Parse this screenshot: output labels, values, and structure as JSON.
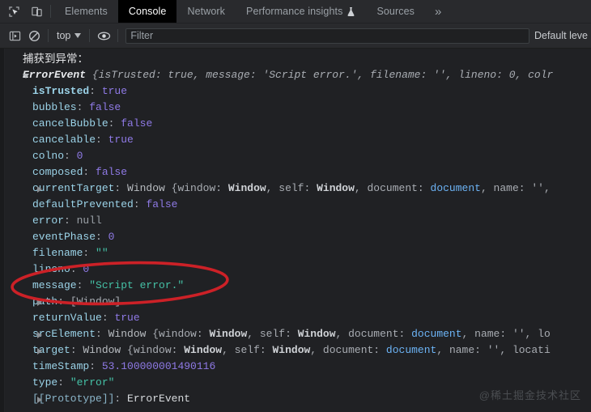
{
  "window": {
    "theme_bg": "#202124",
    "toolbar_bg": "#292a2d",
    "accent_active_tab_bg": "#000000",
    "annotation_color": "#cc2127"
  },
  "tabbar": {
    "icons": [
      {
        "name": "inspect-element-icon",
        "title": "Inspect element"
      },
      {
        "name": "device-toolbar-icon",
        "title": "Toggle device toolbar"
      }
    ],
    "tabs": [
      {
        "label": "Elements",
        "active": false
      },
      {
        "label": "Console",
        "active": true
      },
      {
        "label": "Network",
        "active": false
      },
      {
        "label": "Performance insights",
        "active": false,
        "badge": "flask-icon"
      },
      {
        "label": "Sources",
        "active": false
      }
    ],
    "overflow_label": "»"
  },
  "console_toolbar": {
    "sidebar_toggle": "show-console-sidebar-icon",
    "clear_console": "clear-console-icon",
    "context": {
      "value": "top",
      "caret": "chevron-down-icon"
    },
    "eye_icon": "live-expression-icon",
    "filter": {
      "value": "",
      "placeholder": "Filter"
    },
    "level": "Default leve"
  },
  "console_output": {
    "intro_text": "捕获到异常：",
    "header": {
      "ctor": "ErrorEvent",
      "preview": " {isTrusted: true, message: 'Script error.', filename: '', lineno: 0, colr",
      "expanded": true
    },
    "properties": [
      {
        "key": "isTrusted",
        "sep": ": ",
        "value": "true",
        "vtype": "bool",
        "own": true,
        "expandable": false
      },
      {
        "key": "bubbles",
        "sep": ": ",
        "value": "false",
        "vtype": "bool",
        "own": false,
        "expandable": false
      },
      {
        "key": "cancelBubble",
        "sep": ": ",
        "value": "false",
        "vtype": "bool",
        "own": false,
        "expandable": false
      },
      {
        "key": "cancelable",
        "sep": ": ",
        "value": "true",
        "vtype": "bool",
        "own": false,
        "expandable": false
      },
      {
        "key": "colno",
        "sep": ": ",
        "value": "0",
        "vtype": "num",
        "own": false,
        "expandable": false
      },
      {
        "key": "composed",
        "sep": ": ",
        "value": "false",
        "vtype": "bool",
        "own": false,
        "expandable": false
      },
      {
        "key": "currentTarget",
        "sep": ": ",
        "value": "Window",
        "vtype": "window",
        "own": false,
        "expandable": true
      },
      {
        "key": "defaultPrevented",
        "sep": ": ",
        "value": "false",
        "vtype": "bool",
        "own": false,
        "expandable": false
      },
      {
        "key": "error",
        "sep": ": ",
        "value": "null",
        "vtype": "null",
        "own": false,
        "expandable": false
      },
      {
        "key": "eventPhase",
        "sep": ": ",
        "value": "0",
        "vtype": "num",
        "own": false,
        "expandable": false
      },
      {
        "key": "filename",
        "sep": ": ",
        "value": "\"\"",
        "vtype": "str",
        "own": false,
        "expandable": false
      },
      {
        "key": "lineno",
        "sep": ": ",
        "value": "0",
        "vtype": "num",
        "own": false,
        "expandable": false
      },
      {
        "key": "message",
        "sep": ": ",
        "value": "\"Script error.\"",
        "vtype": "str",
        "own": false,
        "expandable": false
      },
      {
        "key": "path",
        "sep": ": ",
        "value": "[Window]",
        "vtype": "plain",
        "own": false,
        "expandable": true
      },
      {
        "key": "returnValue",
        "sep": ": ",
        "value": "true",
        "vtype": "bool",
        "own": false,
        "expandable": false
      },
      {
        "key": "srcElement",
        "sep": ": ",
        "value": "Window",
        "vtype": "window",
        "own": false,
        "expandable": true
      },
      {
        "key": "target",
        "sep": ": ",
        "value": "Window",
        "vtype": "window",
        "own": false,
        "expandable": true
      },
      {
        "key": "timeStamp",
        "sep": ": ",
        "value": "53.100000001490116",
        "vtype": "num",
        "own": false,
        "expandable": false
      },
      {
        "key": "type",
        "sep": ": ",
        "value": "\"error\"",
        "vtype": "str",
        "own": false,
        "expandable": false
      },
      {
        "key": "[[Prototype]]",
        "sep": ": ",
        "value": "ErrorEvent",
        "vtype": "ctor",
        "own": false,
        "expandable": true
      }
    ],
    "window_preview_currentTarget": " {window: Window, self: Window, document: document, name: '',",
    "window_preview_srcElement": " {window: Window, self: Window, document: document, name: '', lo",
    "window_preview_target": " {window: Window, self: Window, document: document, name: '', locati"
  },
  "annotation": {
    "shape": "ellipse",
    "target_property": "message",
    "color": "#cc2127"
  },
  "watermark": {
    "text": "@稀土掘金技术社区"
  }
}
